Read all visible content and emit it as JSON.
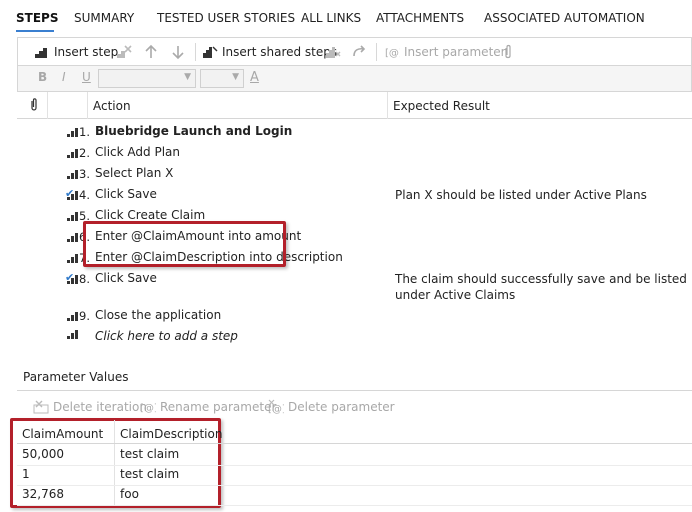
{
  "tabs": [
    "STEPS",
    "SUMMARY",
    "TESTED USER STORIES",
    "ALL LINKS",
    "ATTACHMENTS",
    "ASSOCIATED AUTOMATION"
  ],
  "toolbar": {
    "insert_step": "Insert step",
    "insert_shared_steps": "Insert shared steps",
    "insert_parameter": "Insert parameter"
  },
  "format": {
    "bold": "B",
    "italic": "I",
    "underline": "U",
    "font_color": "A"
  },
  "grid": {
    "col_action": "Action",
    "col_expected": "Expected Result"
  },
  "steps": [
    {
      "num": "1.",
      "action": "Bluebridge Launch and Login",
      "expected": "",
      "bold": true,
      "checked": false
    },
    {
      "num": "2.",
      "action": "Click Add Plan",
      "expected": "",
      "bold": false,
      "checked": false
    },
    {
      "num": "3.",
      "action": "Select Plan X",
      "expected": "",
      "bold": false,
      "checked": false
    },
    {
      "num": "4.",
      "action": "Click Save",
      "expected": "Plan X should be listed under Active Plans",
      "bold": false,
      "checked": true
    },
    {
      "num": "5.",
      "action": "Click Create Claim",
      "expected": "",
      "bold": false,
      "checked": false
    },
    {
      "num": "6.",
      "action": "Enter @ClaimAmount into amount",
      "expected": "",
      "bold": false,
      "checked": false
    },
    {
      "num": "7.",
      "action": "Enter @ClaimDescription into description",
      "expected": "",
      "bold": false,
      "checked": false
    },
    {
      "num": "8.",
      "action": "Click Save",
      "expected": "The claim should successfully save and be listed under Active Claims",
      "bold": false,
      "checked": true
    },
    {
      "num": "9.",
      "action": "Close the application",
      "expected": "",
      "bold": false,
      "checked": false
    }
  ],
  "add_step_prompt": "Click here to add a step",
  "parameters": {
    "title": "Parameter Values",
    "toolbar": {
      "delete_iteration": "Delete iteration",
      "rename_parameter": "Rename parameter",
      "delete_parameter": "Delete parameter"
    },
    "columns": [
      "ClaimAmount",
      "ClaimDescription"
    ],
    "rows": [
      [
        "50,000",
        "test claim"
      ],
      [
        "1",
        "test claim"
      ],
      [
        "32,768",
        "foo"
      ]
    ]
  },
  "colors": {
    "accent": "#3a7fd0",
    "highlight": "#b3202a",
    "check": "#2f79c9"
  }
}
